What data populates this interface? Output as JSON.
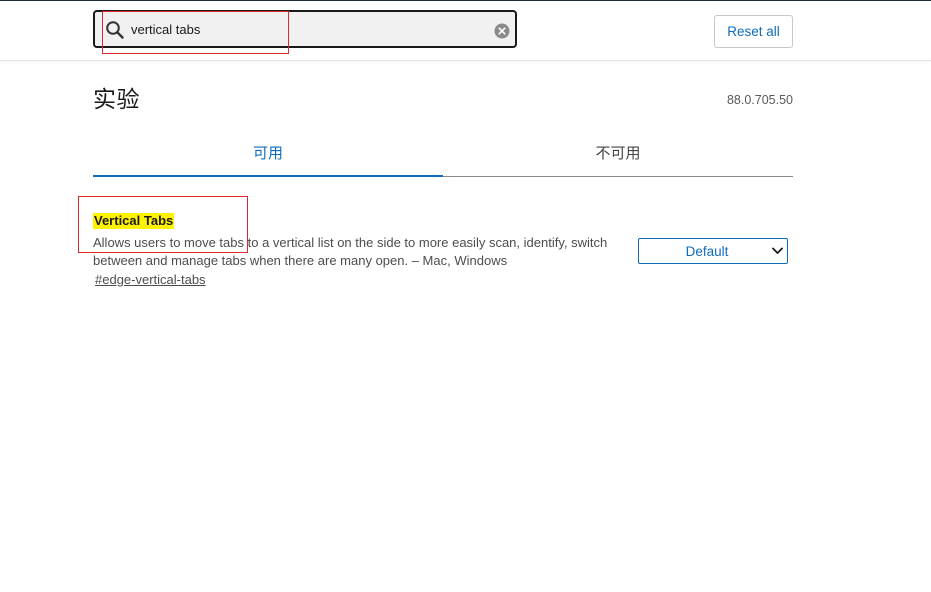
{
  "search": {
    "value": "vertical tabs",
    "placeholder": ""
  },
  "header": {
    "reset_label": "Reset all"
  },
  "page": {
    "title": "实验",
    "version": "88.0.705.50"
  },
  "tabs": [
    {
      "label": "可用",
      "active": true
    },
    {
      "label": "不可用",
      "active": false
    }
  ],
  "flag": {
    "title": "Vertical Tabs",
    "description": "Allows users to move tabs to a vertical list on the side to more easily scan, identify, switch between and manage tabs when there are many open. – Mac, Windows",
    "link": "#edge-vertical-tabs",
    "selected": "Default"
  },
  "colors": {
    "accent": "#0f6cbd",
    "highlight": "#fff200",
    "annotation": "#e0292e"
  },
  "icons": [
    "search-icon",
    "clear-icon",
    "chevron-down-icon"
  ]
}
